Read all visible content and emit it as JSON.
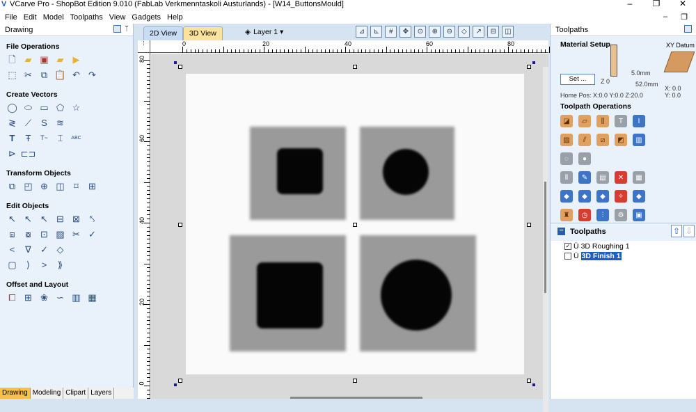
{
  "window": {
    "title": "VCarve Pro - ShopBot Edition 9.010 (FabLab Verkmenntaskoli Austurlands) - [W14_ButtonsMould]",
    "minimize": "–",
    "restore": "❐",
    "close": ""
  },
  "menu": {
    "items": [
      "File",
      "Edit",
      "Model",
      "Toolpaths",
      "View",
      "Gadgets",
      "Help"
    ],
    "mdi_min": "–",
    "mdi_restore": "❐"
  },
  "left_panel": {
    "title": "Drawing",
    "sections": [
      {
        "title": "File Operations",
        "rows": [
          [
            "new-file",
            "open-file",
            "save-file",
            "open-folder",
            "import"
          ],
          [
            "select-all",
            "cut",
            "copy",
            "paste",
            "undo",
            "redo"
          ]
        ]
      },
      {
        "title": "Create Vectors",
        "rows": [
          [
            "circle",
            "ellipse",
            "rectangle",
            "polygon",
            "star"
          ],
          [
            "polyline",
            "line",
            "curve",
            "spiral"
          ],
          [
            "text",
            "text-on-curve",
            "text-arc",
            "text-fit",
            "abc-text"
          ],
          [
            "dimension",
            "measure"
          ]
        ]
      },
      {
        "title": "Transform Objects",
        "rows": [
          [
            "move",
            "scale",
            "align",
            "mirror",
            "distort",
            "center"
          ]
        ]
      },
      {
        "title": "Edit Objects",
        "rows": [
          [
            "select",
            "node-edit",
            "smooth",
            "group",
            "ungroup",
            "trim"
          ],
          [
            "weld",
            "subtract",
            "intersect",
            "hatch",
            "scissors",
            "close"
          ],
          [
            "chevron",
            "v-shape",
            "check",
            "diamond"
          ],
          [
            "rounded",
            "bracket",
            "angle",
            "bracket2"
          ]
        ]
      },
      {
        "title": "Offset and Layout",
        "rows": [
          [
            "offset",
            "array",
            "circular",
            "curve-layout",
            "nest",
            "pattern"
          ]
        ]
      }
    ],
    "tabs": [
      "Drawing",
      "Modeling",
      "Clipart",
      "Layers"
    ]
  },
  "view": {
    "tab_2d": "2D View",
    "tab_3d": "3D View",
    "layer": "Layer 1 ▾",
    "ruler_top": [
      "0",
      "20",
      "40",
      "60",
      "80"
    ],
    "ruler_left": [
      "80",
      "60",
      "40",
      "20",
      "0"
    ]
  },
  "right_panel": {
    "title": "Toolpaths",
    "material_setup": {
      "title": "Material Setup",
      "set_button": "Set ...",
      "z0": "Z 0",
      "thickness_top": "5.0mm",
      "thickness": "52.0mm",
      "home_pos": "Home Pos:  X:0.0 Y:0.0 Z:20.0",
      "xy_datum": "XY Datum",
      "datum_x": "X: 0.0",
      "datum_y": "Y: 0.0"
    },
    "operations_title": "Toolpath Operations",
    "operations_rows": [
      [
        "profile",
        "pocket",
        "drill",
        "inlay",
        "v-carve"
      ],
      [
        "texture",
        "fluting",
        "prism",
        "roughing",
        "finish"
      ],
      [
        "moulding",
        "sphere"
      ],
      [
        "tool-list",
        "edit-toolpath",
        "summary",
        "delete",
        "calculator"
      ],
      [
        "preview",
        "preview-selected",
        "preview-all",
        "merge",
        "template"
      ],
      [
        "sim",
        "clock",
        "slice",
        "settings",
        "save-toolpath"
      ]
    ],
    "toolpaths_title": "Toolpaths",
    "toolpaths": [
      {
        "name": "3D Roughing 1",
        "checked": true
      },
      {
        "name": "3D Finish 1",
        "checked": false
      }
    ]
  }
}
